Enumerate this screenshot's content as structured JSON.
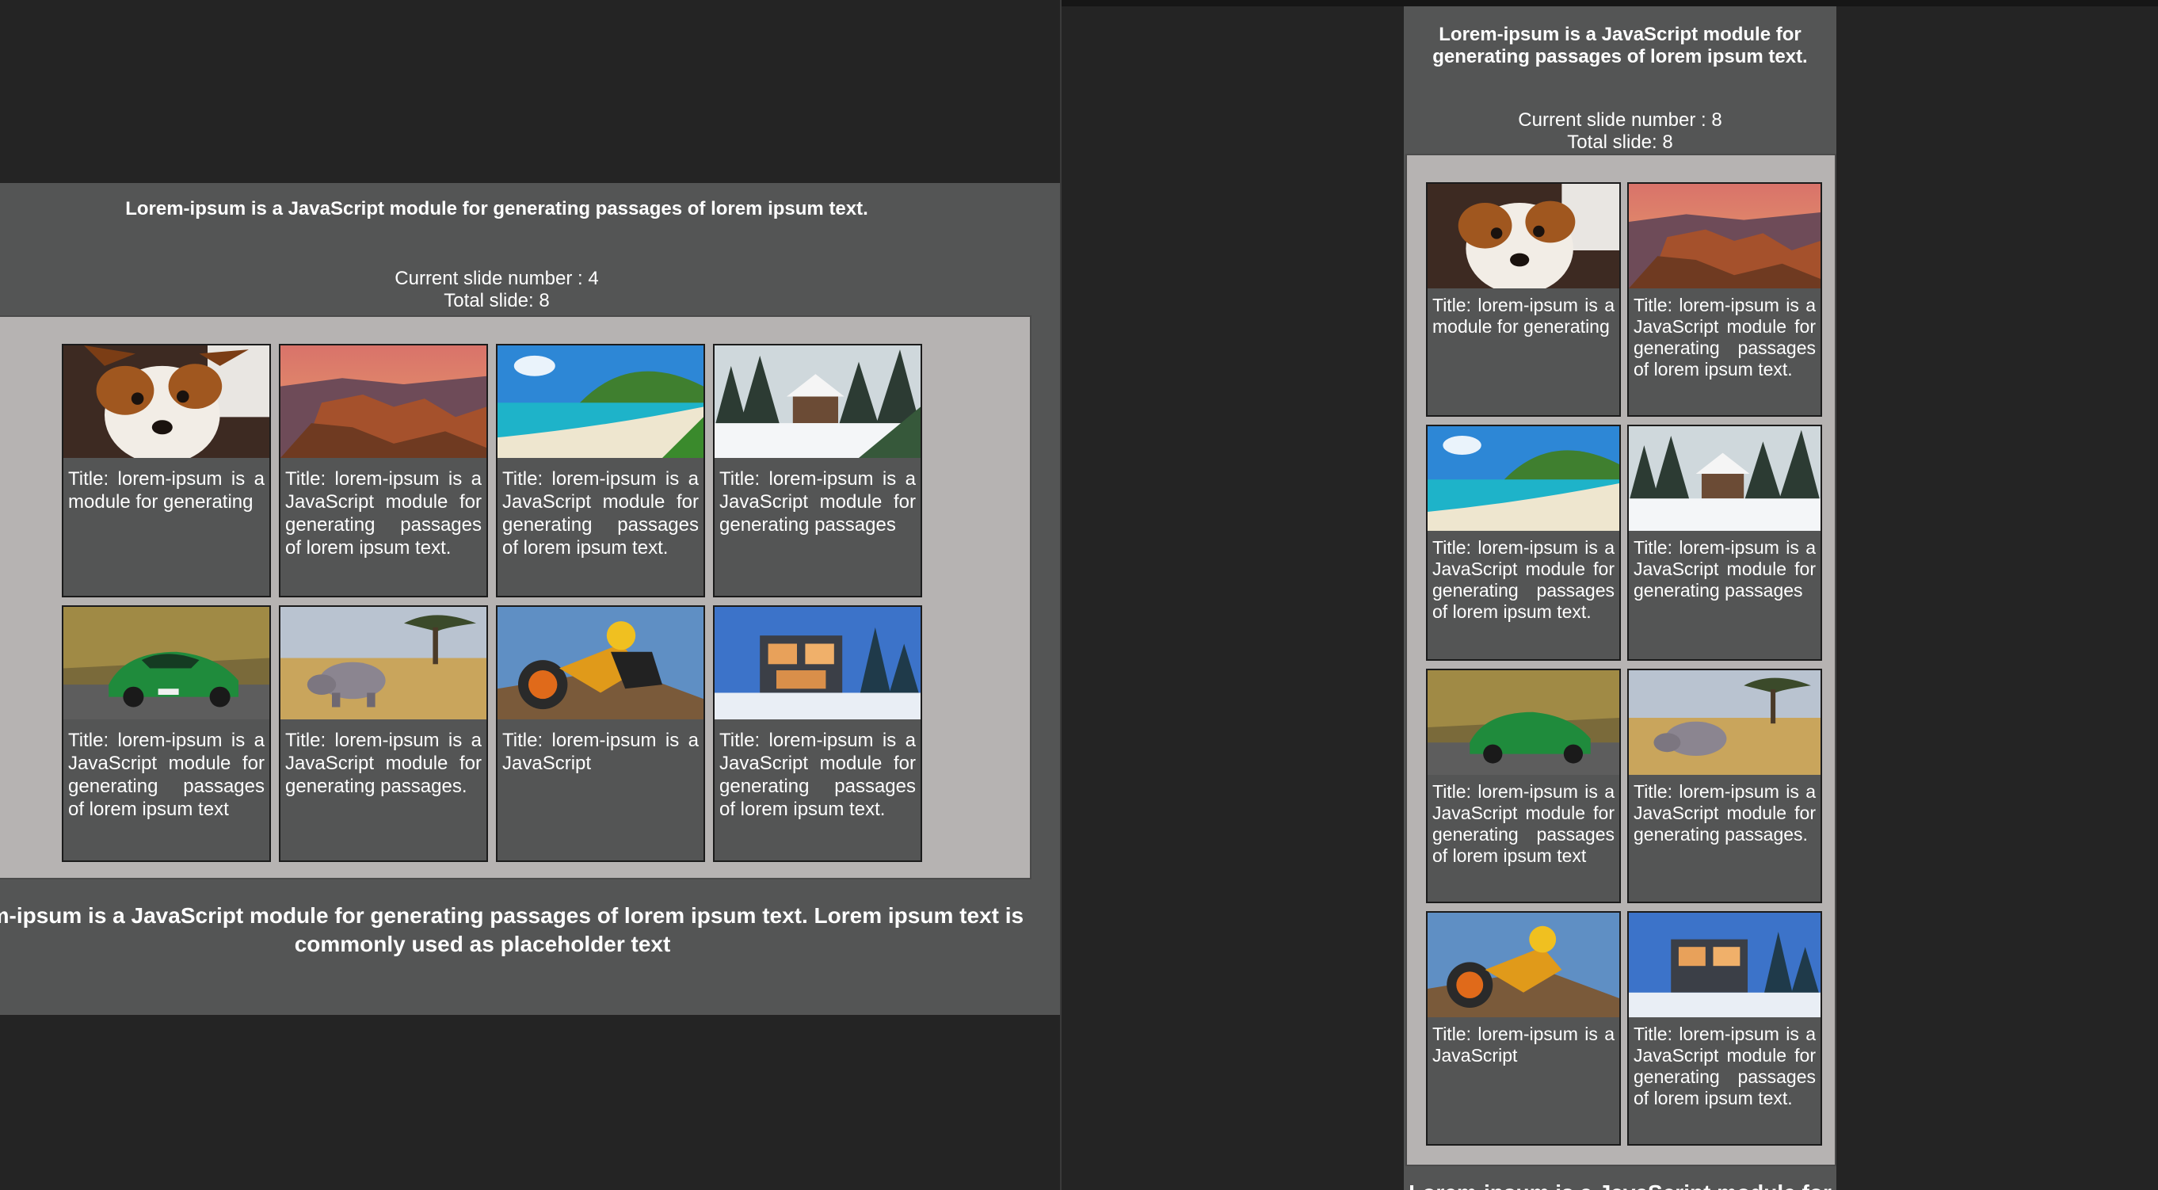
{
  "left_pane": {
    "title": "Lorem-ipsum is a JavaScript module for generating passages of lorem ipsum text.",
    "current_slide_label": "Current slide number : 4",
    "total_slide_label": "Total slide: 8",
    "footer_text": "Lorem-ipsum is a JavaScript module for generating passages of lorem ipsum text. Lorem ipsum text is commonly used as placeholder text"
  },
  "right_pane": {
    "title": "Lorem-ipsum is a JavaScript module for generating passages of lorem ipsum text.",
    "current_slide_label": "Current slide number : 8",
    "total_slide_label": "Total slide: 8",
    "footer_text": "Lorem-ipsum is a JavaScript module for"
  },
  "cards": [
    {
      "image": "dog-photo",
      "caption": "Title: lorem-ipsum is a module for generating"
    },
    {
      "image": "canyon-photo",
      "caption": "Title: lorem-ipsum is a JavaScript module for generating passages of lorem ipsum text."
    },
    {
      "image": "beach-photo",
      "caption": "Title: lorem-ipsum is a JavaScript module for generating passages of lorem ipsum text."
    },
    {
      "image": "snow-cabin-photo",
      "caption": "Title: lorem-ipsum is a JavaScript module for generating passages"
    },
    {
      "image": "green-car-photo",
      "caption": "Title: lorem-ipsum is a JavaScript module for generating passages of lorem ipsum text"
    },
    {
      "image": "rhino-photo",
      "caption": "Title: lorem-ipsum is a JavaScript module for generating passages."
    },
    {
      "image": "motocross-photo",
      "caption": "Title: lorem-ipsum is a JavaScript"
    },
    {
      "image": "winter-house-photo",
      "caption": "Title: lorem-ipsum is a JavaScript module for generating passages of lorem ipsum text."
    }
  ]
}
